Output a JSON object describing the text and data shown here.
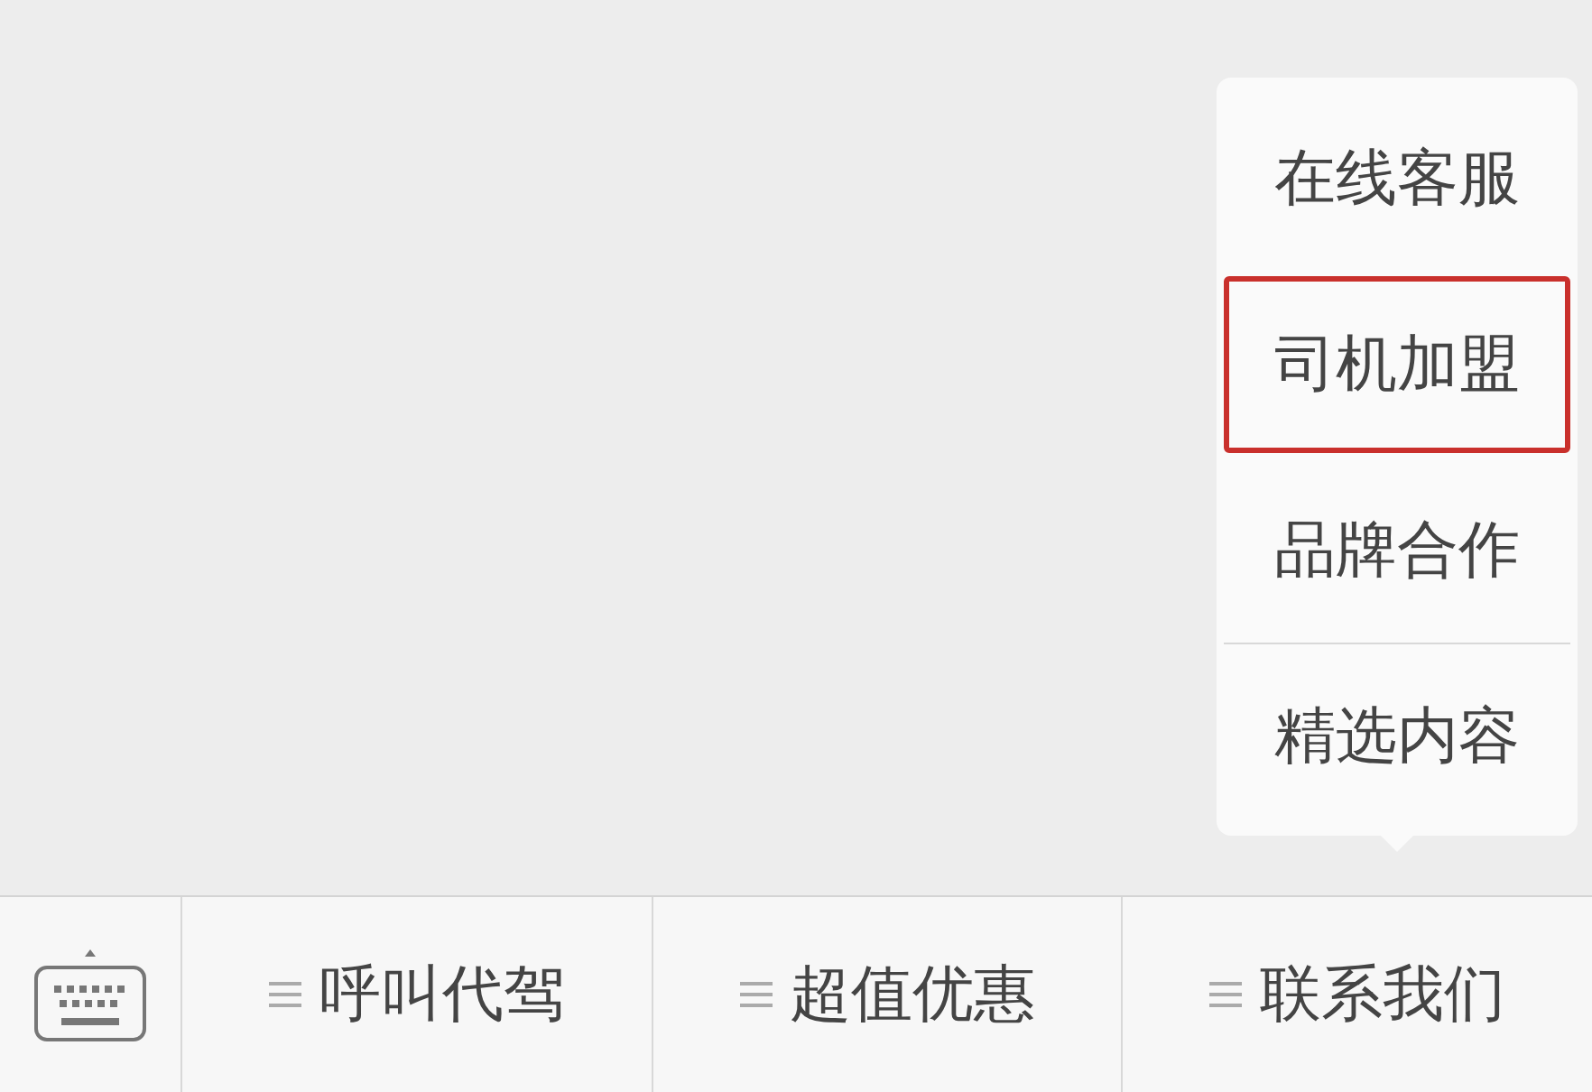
{
  "popup_menu": {
    "items": [
      {
        "label": "在线客服",
        "highlighted": false
      },
      {
        "label": "司机加盟",
        "highlighted": true
      },
      {
        "label": "品牌合作",
        "highlighted": false
      },
      {
        "label": "精选内容",
        "highlighted": false
      }
    ]
  },
  "menu_bar": {
    "items": [
      {
        "label": "呼叫代驾"
      },
      {
        "label": "超值优惠"
      },
      {
        "label": "联系我们"
      }
    ]
  }
}
